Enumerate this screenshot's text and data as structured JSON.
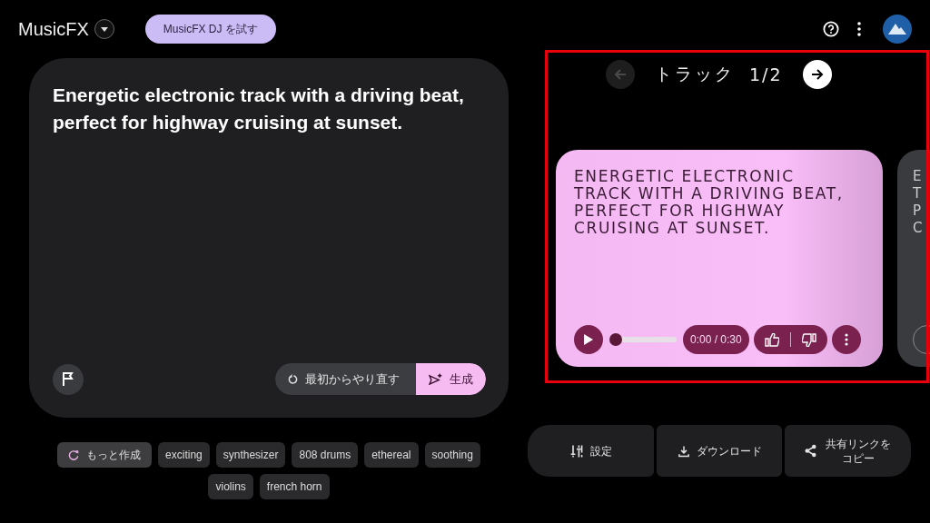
{
  "header": {
    "title": "MusicFX",
    "dj_button": "MusicFX DJ を試す"
  },
  "prompt": {
    "text": "Energetic electronic track with a driving beat, perfect for highway cruising at sunset.",
    "restart_button": "最初からやり直す",
    "generate_button": "生成"
  },
  "chips": [
    {
      "label": "もっと作成",
      "kind": "more"
    },
    {
      "label": "exciting",
      "kind": "tag"
    },
    {
      "label": "synthesizer",
      "kind": "tag"
    },
    {
      "label": "808 drums",
      "kind": "tag"
    },
    {
      "label": "ethereal",
      "kind": "tag"
    },
    {
      "label": "soothing",
      "kind": "tag"
    },
    {
      "label": "violins",
      "kind": "tag"
    },
    {
      "label": "french horn",
      "kind": "tag"
    }
  ],
  "track_nav": {
    "label": "トラック",
    "counter": "1/2",
    "prev_disabled": true,
    "next_disabled": false
  },
  "track_card": {
    "title": "ENERGETIC ELECTRONIC TRACK WITH A DRIVING BEAT, PERFECT FOR HIGHWAY CRUISING AT SUNSET.",
    "time": "0:00 / 0:30",
    "level": 0
  },
  "peek_card": {
    "lines": [
      "E",
      "T",
      "P",
      "C"
    ]
  },
  "actions": [
    {
      "label": "設定",
      "kind": "settings"
    },
    {
      "label": "ダウンロード",
      "kind": "download"
    },
    {
      "label": "共有リンクをコピー",
      "kind": "share"
    }
  ],
  "highlight_frame": true
}
